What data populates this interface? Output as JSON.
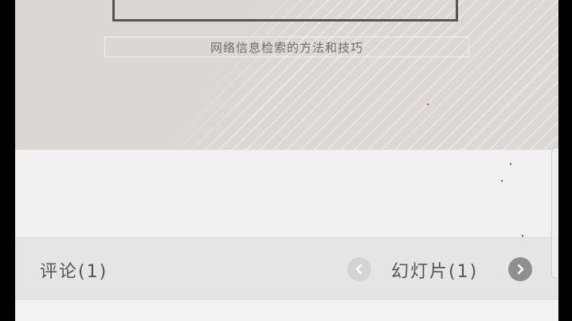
{
  "slide": {
    "subtitle": "网络信息检索的方法和技巧"
  },
  "bottom_bar": {
    "comments_label": "评论(1)",
    "slides_label": "幻灯片(1)"
  },
  "icons": {
    "prev": "chevron-left-icon",
    "next": "chevron-right-icon"
  },
  "colors": {
    "slide_bg": "#dbd8d4",
    "bar_bg": "#e5e5e5",
    "next_button": "#8f8f8f",
    "prev_button": "#d4d4d4"
  }
}
